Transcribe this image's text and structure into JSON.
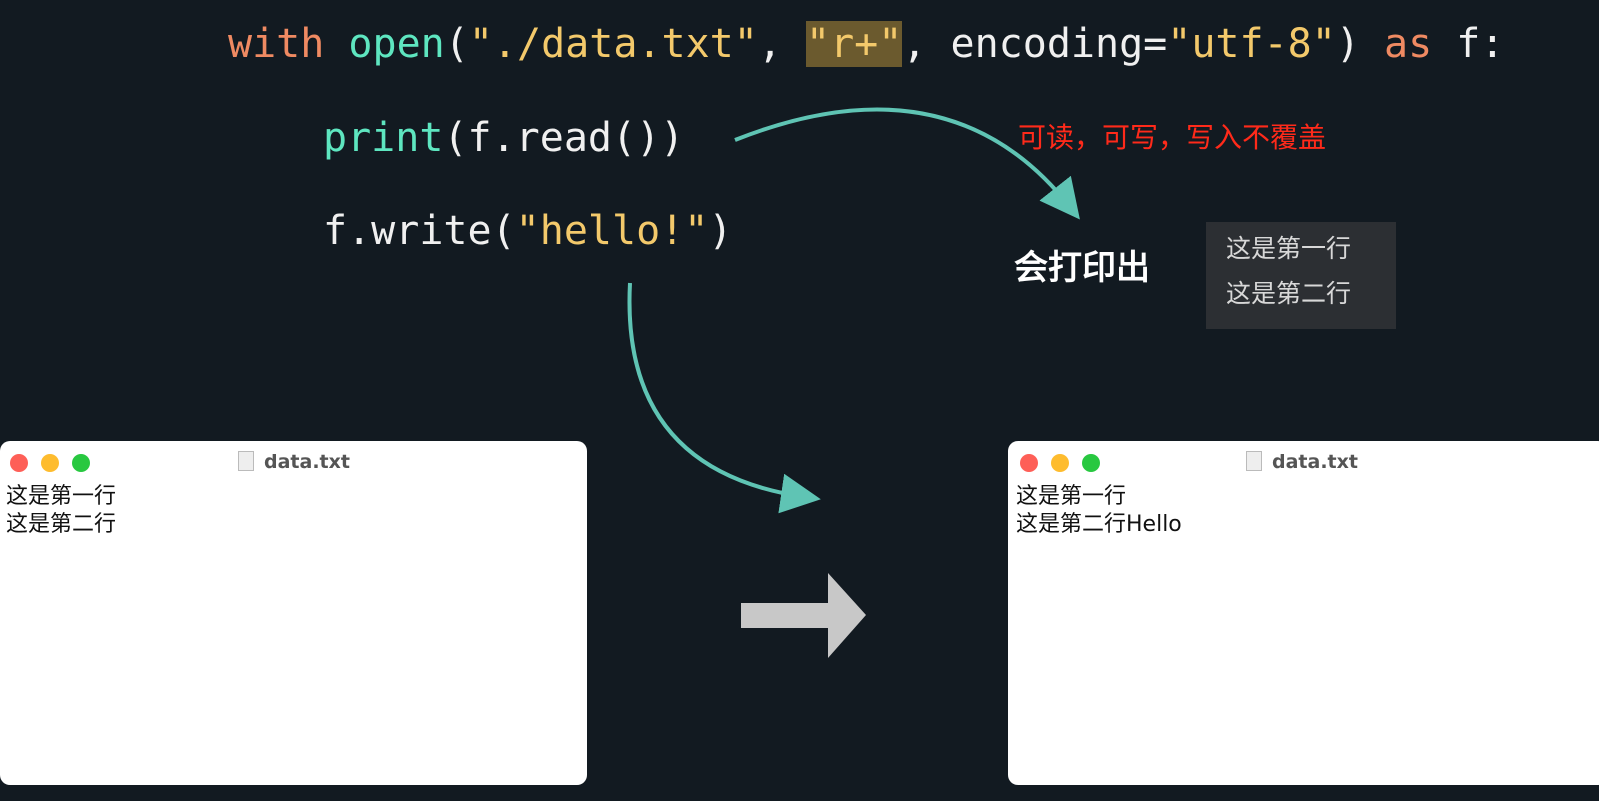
{
  "code": {
    "line1": {
      "kw_with": "with",
      "fn_open": "open",
      "p1": "(",
      "path": "\"./data.txt\"",
      "c1": ", ",
      "mode": "\"r+\"",
      "c2": ", encoding=",
      "enc": "\"utf-8\"",
      "p2": ")",
      "kw_as": " as",
      "tail": " f:"
    },
    "line2": {
      "fn": "print",
      "rest": "(f.read())"
    },
    "line3": {
      "pre": "f.write(",
      "str": "\"hello!\"",
      "post": ")"
    }
  },
  "annotation": "可读，可写，写入不覆盖",
  "print_label": "会打印出",
  "print_output": [
    "这是第一行",
    "这是第二行"
  ],
  "windows": {
    "before": {
      "title": "data.txt",
      "lines": [
        "这是第一行",
        "这是第二行"
      ]
    },
    "after": {
      "title": "data.txt",
      "lines": [
        "这是第一行",
        "这是第二行Hello"
      ]
    }
  },
  "colors": {
    "keyword": "#ef8a62",
    "function": "#5ee6c0",
    "string": "#f3c96b",
    "arrow": "#5fc4b4",
    "note": "#ff2a1a"
  }
}
